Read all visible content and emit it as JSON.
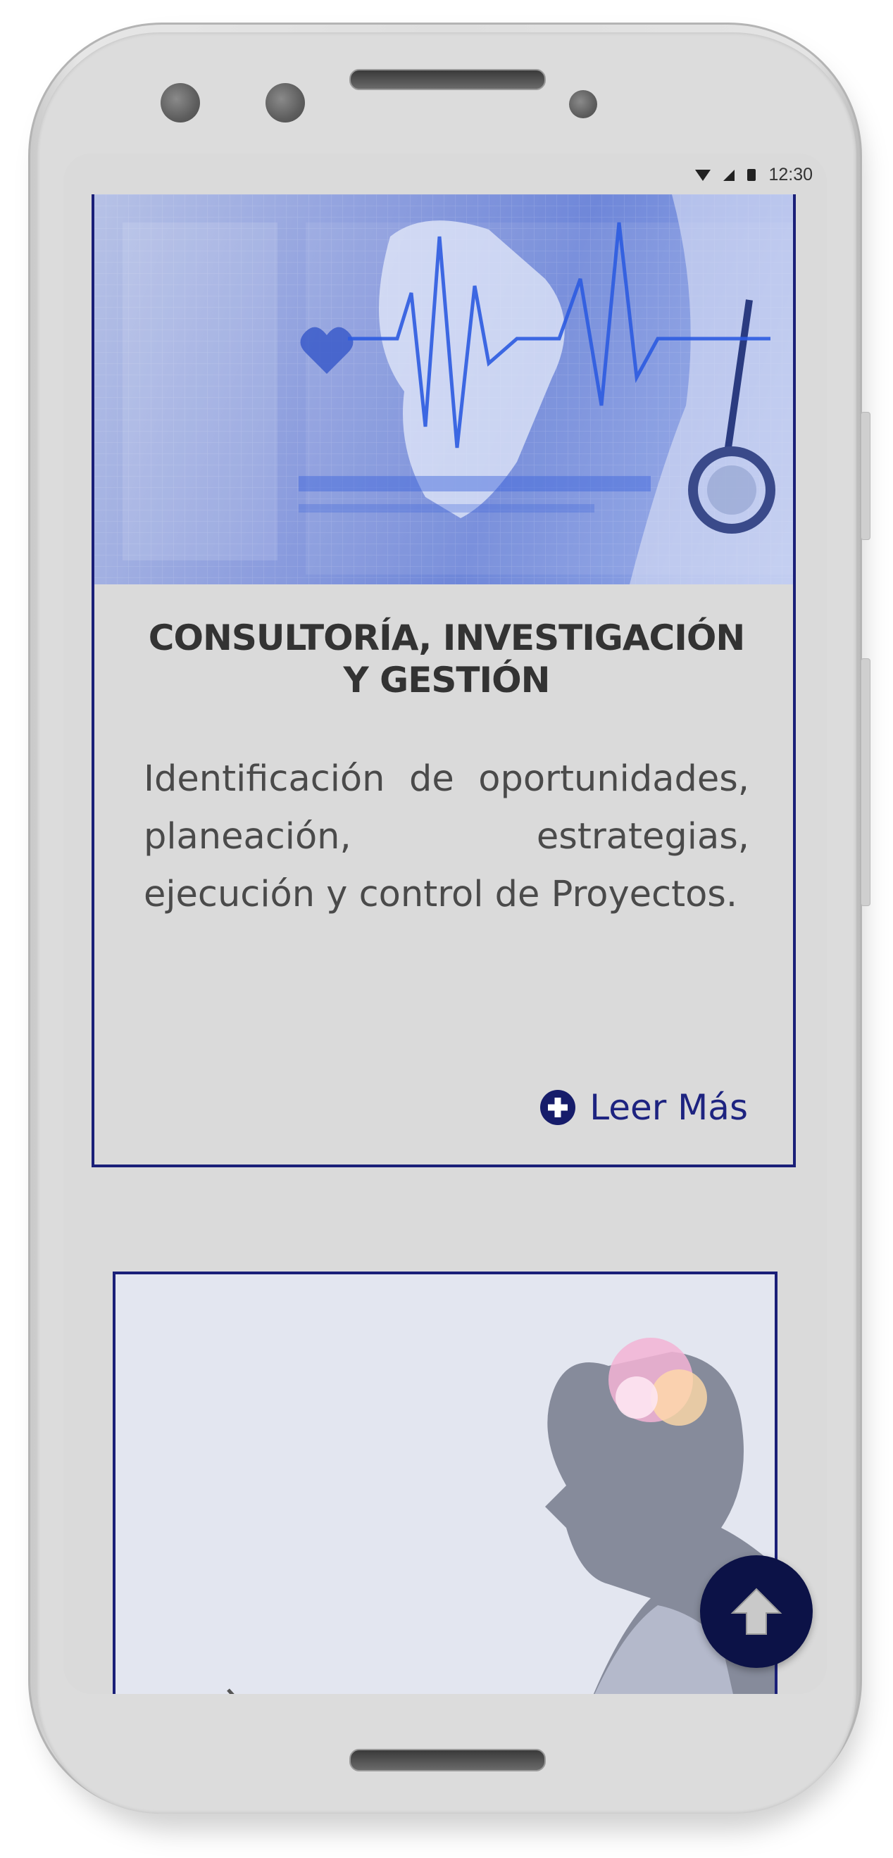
{
  "status_bar": {
    "time": "12:30",
    "icons": [
      "wifi-icon",
      "signal-icon",
      "battery-icon"
    ]
  },
  "card1": {
    "image": "heartbeat-medical-image",
    "title": "CONSULTORÍA, INVESTIGACIÓN Y GESTIÓN",
    "description": "Identificación de oportunidades, planeación, estrategias, ejecución y control de Proyectos.",
    "read_more_icon": "plus-circle-icon",
    "read_more_label": "Leer Más"
  },
  "card2": {
    "image": "man-brain-glow-image"
  },
  "scroll_top_button": {
    "icon": "arrow-up-icon"
  },
  "colors": {
    "accent": "#1a1f78",
    "fab": "#0c1247",
    "text": "#333333"
  }
}
